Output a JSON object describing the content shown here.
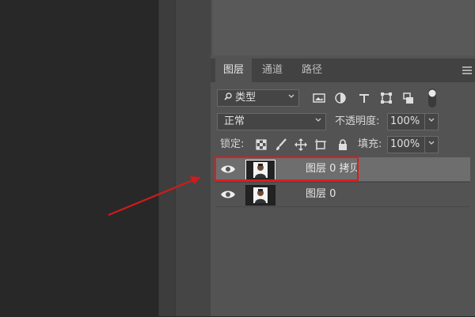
{
  "panel": {
    "tabs": [
      {
        "label": "图层",
        "active": true
      },
      {
        "label": "通道",
        "active": false
      },
      {
        "label": "路径",
        "active": false
      }
    ],
    "filter": {
      "selected": "类型"
    },
    "blend": {
      "mode": "正常",
      "opacity_label": "不透明度:",
      "opacity_value": "100%"
    },
    "lock": {
      "label": "锁定:",
      "fill_label": "填充:",
      "fill_value": "100%"
    },
    "layers": [
      {
        "name": "图层 0 拷贝",
        "selected": true
      },
      {
        "name": "图层 0",
        "selected": false
      }
    ]
  },
  "colors": {
    "highlight": "#e01b1b",
    "panel_bg": "#535353",
    "selected_row": "#6e6e6e"
  }
}
